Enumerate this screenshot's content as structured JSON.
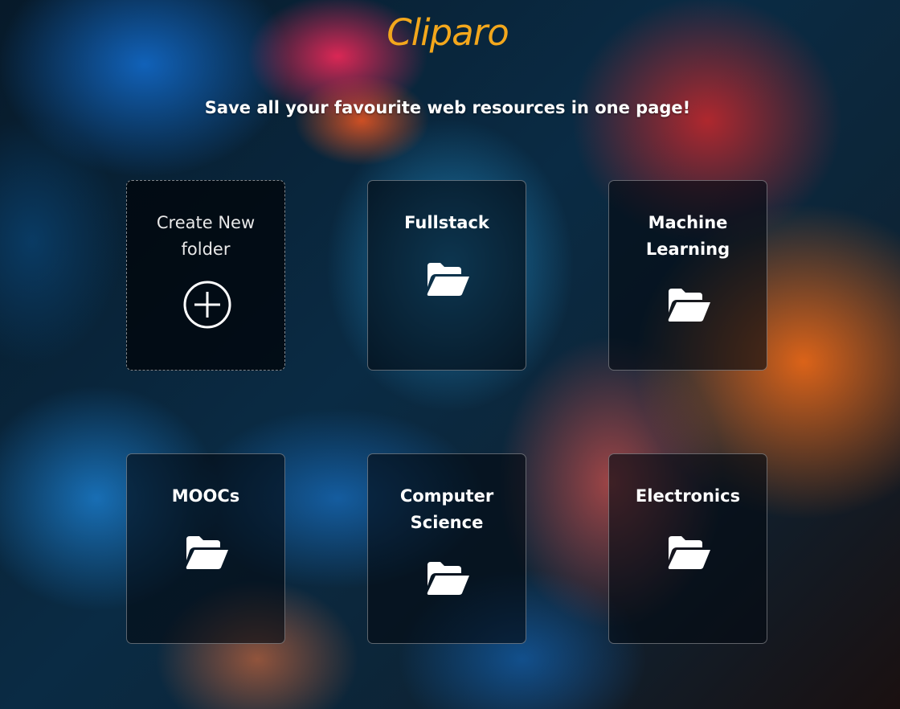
{
  "header": {
    "brand": "Cliparo",
    "tagline": "Save all your favourite web resources in one page!"
  },
  "colors": {
    "brand": "#f3a71c",
    "text": "#ffffff"
  },
  "create_card": {
    "label": "Create New folder",
    "icon": "plus-circle-icon"
  },
  "folders": [
    {
      "label": "Fullstack",
      "icon": "folder-open-icon"
    },
    {
      "label": "Machine Learning",
      "icon": "folder-open-icon"
    },
    {
      "label": "MOOCs",
      "icon": "folder-open-icon"
    },
    {
      "label": "Computer Science",
      "icon": "folder-open-icon"
    },
    {
      "label": "Electronics",
      "icon": "folder-open-icon"
    }
  ]
}
